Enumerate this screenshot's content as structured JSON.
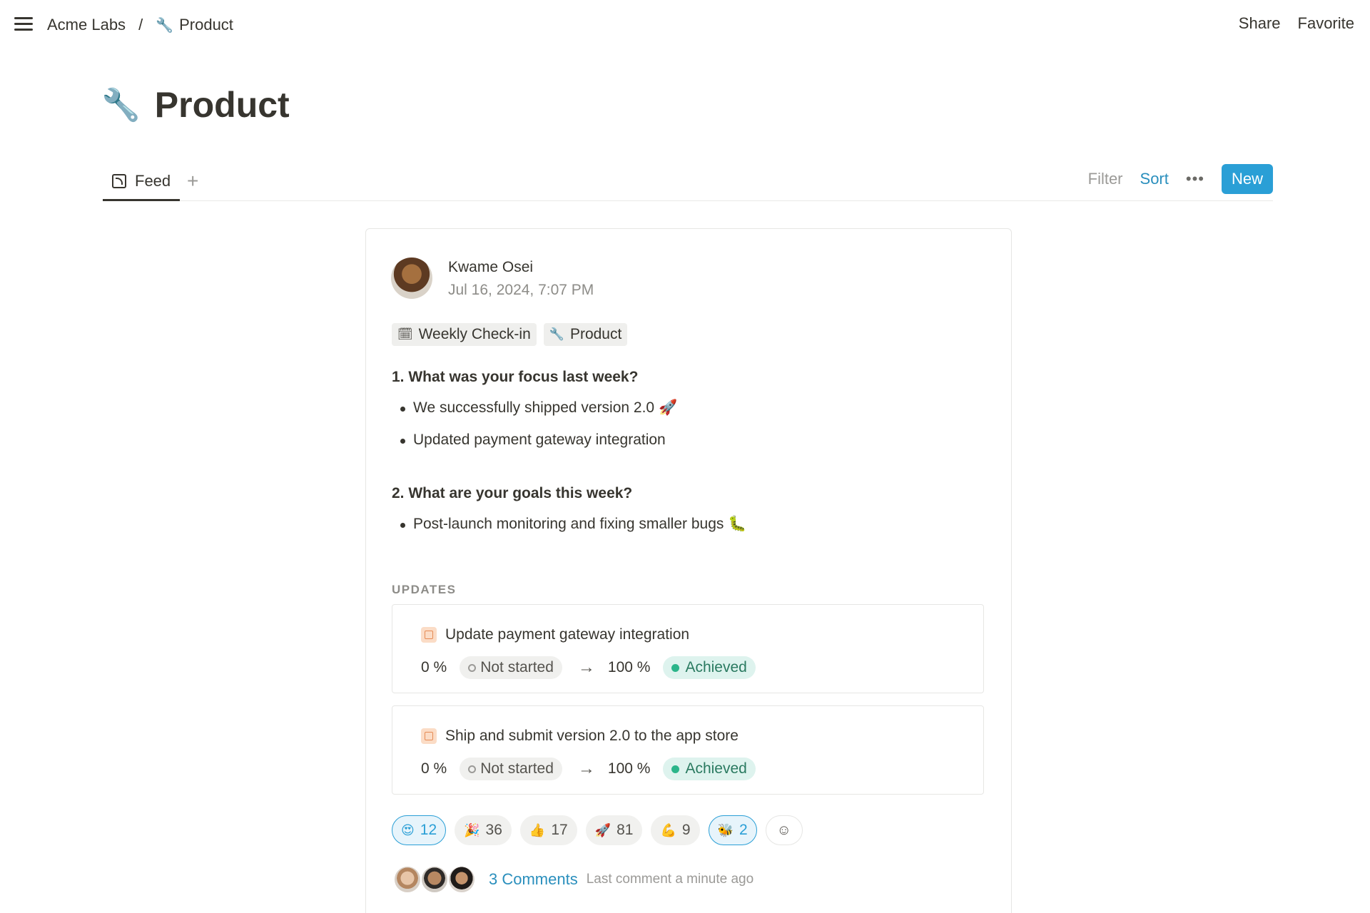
{
  "topbar": {
    "breadcrumb": [
      {
        "label": "Acme Labs",
        "icon": ""
      },
      {
        "label": "Product",
        "icon": "🔧"
      }
    ],
    "separator": "/",
    "share_label": "Share",
    "favorite_label": "Favorite"
  },
  "page": {
    "icon": "🔧",
    "title": "Product"
  },
  "tabs": {
    "items": [
      {
        "label": "Feed",
        "icon": "feed-icon"
      }
    ],
    "add_label": "+",
    "filter_label": "Filter",
    "sort_label": "Sort",
    "more_label": "•••",
    "new_label": "New"
  },
  "post": {
    "author": "Kwame Osei",
    "date": "Jul 16, 2024, 7:07 PM",
    "tags": [
      {
        "icon": "🗓",
        "label": "Weekly Check-in"
      },
      {
        "icon": "🔧",
        "label": "Product"
      }
    ],
    "q1": "1. What was your focus last week?",
    "q1_bullets": [
      "We successfully shipped version 2.0 🚀",
      "Updated payment gateway integration"
    ],
    "q2": "2. What are your goals this week?",
    "q2_bullets": [
      "Post-launch monitoring and fixing smaller bugs 🐛"
    ],
    "updates_label": "UPDATES",
    "updates": [
      {
        "title": "Update payment gateway integration",
        "from_pct": "0 %",
        "from_status": "Not started",
        "to_pct": "100 %",
        "to_status": "Achieved"
      },
      {
        "title": "Ship and submit version 2.0 to the app store",
        "from_pct": "0 %",
        "from_status": "Not started",
        "to_pct": "100 %",
        "to_status": "Achieved"
      }
    ],
    "arrow": "→",
    "reactions": [
      {
        "emoji": "😍",
        "count": "12",
        "active": true
      },
      {
        "emoji": "🎉",
        "count": "36",
        "active": false
      },
      {
        "emoji": "👍",
        "count": "17",
        "active": false
      },
      {
        "emoji": "🚀",
        "count": "81",
        "active": false
      },
      {
        "emoji": "💪",
        "count": "9",
        "active": false
      },
      {
        "emoji": "🐝",
        "count": "2",
        "active": true
      }
    ],
    "add_reaction_icon": "☺",
    "comments_label": "3 Comments",
    "comments_meta": "Last comment a minute ago"
  },
  "colors": {
    "accent": "#2a9fd6",
    "achieved_bg": "#def3ee",
    "achieved_dot": "#2bb58a",
    "not_started_bg": "#f0f0ee"
  }
}
